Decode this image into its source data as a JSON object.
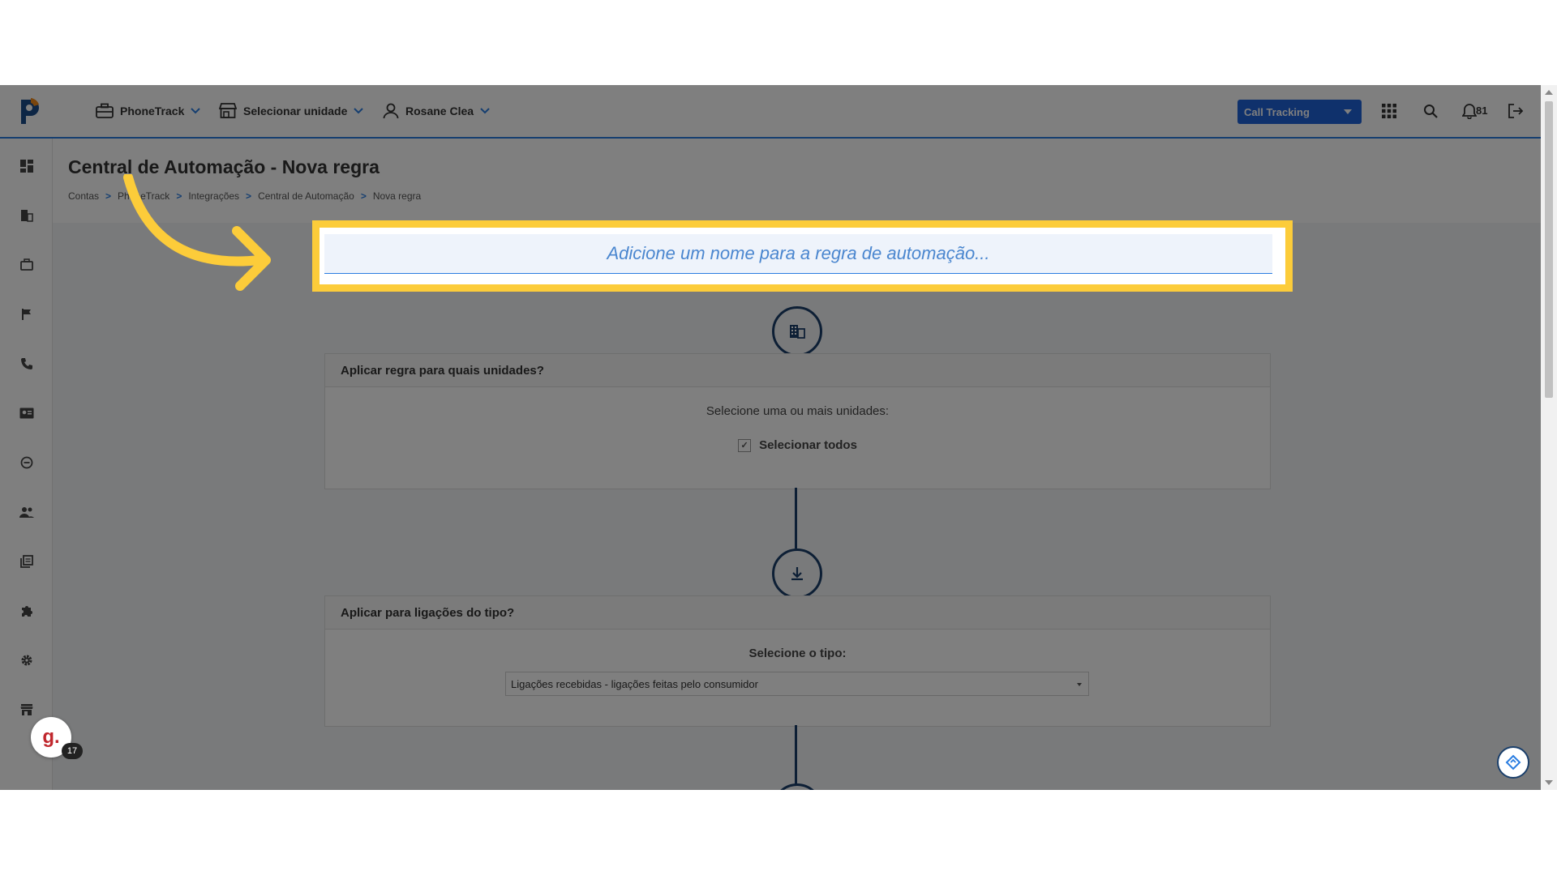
{
  "header": {
    "nav": [
      {
        "label": "PhoneTrack"
      },
      {
        "label": "Selecionar unidade"
      },
      {
        "label": "Rosane Clea"
      }
    ],
    "product_select": "Call Tracking",
    "notifications_count": "81"
  },
  "page": {
    "title": "Central de Automação - Nova regra",
    "breadcrumb": [
      "Contas",
      "PhoneTrack",
      "Integrações",
      "Central de Automação",
      "Nova regra"
    ],
    "breadcrumb_sep": ">"
  },
  "rule_name": {
    "placeholder": "Adicione um nome para a regra de automação..."
  },
  "units_card": {
    "header": "Aplicar regra para quais unidades?",
    "prompt": "Selecione uma ou mais unidades:",
    "select_all_label": "Selecionar todos",
    "select_all_checked": true
  },
  "type_card": {
    "header": "Aplicar para ligações do tipo?",
    "prompt": "Selecione o tipo:",
    "selected_value": "Ligações recebidas - ligações feitas pelo consumidor"
  },
  "widgets": {
    "g_letter": "g.",
    "g_badge": "17"
  },
  "colors": {
    "accent": "#1f63d8",
    "highlight": "#fccc3a",
    "step": "#1a3f6b"
  }
}
